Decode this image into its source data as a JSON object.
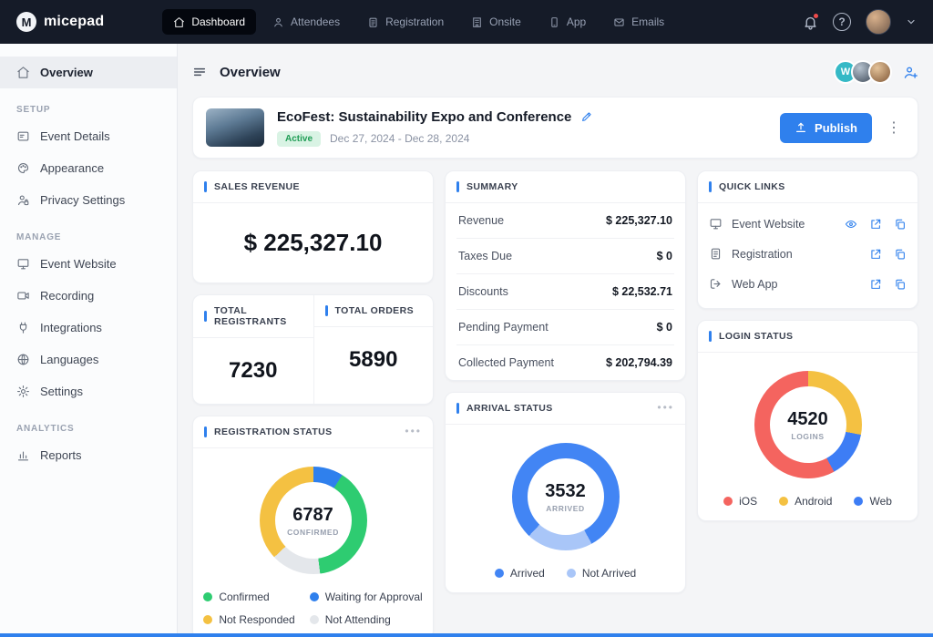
{
  "topbar": {
    "brand": "micepad",
    "nav": [
      {
        "label": "Dashboard"
      },
      {
        "label": "Attendees"
      },
      {
        "label": "Registration"
      },
      {
        "label": "Onsite"
      },
      {
        "label": "App"
      },
      {
        "label": "Emails"
      }
    ]
  },
  "glyphs": {
    "kebab": "⋮",
    "ellipsis": "•••",
    "chevron": "⌄",
    "question": "?"
  },
  "sidebar": {
    "overview": "Overview",
    "sections": [
      {
        "title": "Setup",
        "items": [
          {
            "label": "Event Details"
          },
          {
            "label": "Appearance"
          },
          {
            "label": "Privacy Settings"
          }
        ]
      },
      {
        "title": "Manage",
        "items": [
          {
            "label": "Event Website"
          },
          {
            "label": "Recording"
          },
          {
            "label": "Integrations"
          },
          {
            "label": "Languages"
          },
          {
            "label": "Settings"
          }
        ]
      },
      {
        "title": "Analytics",
        "items": [
          {
            "label": "Reports"
          }
        ]
      }
    ]
  },
  "header": {
    "title": "Overview",
    "collab_initial": "W"
  },
  "event": {
    "title": "EcoFest: Sustainability Expo and Conference",
    "status": "Active",
    "dates": "Dec 27, 2024 - Dec 28, 2024",
    "publish_label": "Publish"
  },
  "sales": {
    "title": "SALES REVENUE",
    "value": "$ 225,327.10"
  },
  "totals": {
    "registrants": {
      "title": "TOTAL REGISTRANTS",
      "value": "7230"
    },
    "orders": {
      "title": "TOTAL ORDERS",
      "value": "5890"
    }
  },
  "summary": {
    "title": "SUMMARY",
    "rows": [
      {
        "label": "Revenue",
        "value": "$ 225,327.10"
      },
      {
        "label": "Taxes Due",
        "value": "$ 0"
      },
      {
        "label": "Discounts",
        "value": "$ 22,532.71"
      },
      {
        "label": "Pending Payment",
        "value": "$ 0"
      },
      {
        "label": "Collected Payment",
        "value": "$ 202,794.39"
      }
    ]
  },
  "quick_links": {
    "title": "QUICK LINKS",
    "items": [
      {
        "label": "Event Website"
      },
      {
        "label": "Registration"
      },
      {
        "label": "Web App"
      }
    ]
  },
  "charts": {
    "registration": {
      "title": "REGISTRATION STATUS",
      "center_value": "6787",
      "center_label": "CONFIRMED",
      "type": "donut",
      "slices": [
        {
          "color": "#2f80ed",
          "pct": 9
        },
        {
          "color": "#2ecc71",
          "pct": 39
        },
        {
          "color": "#e4e7eb",
          "pct": 15
        },
        {
          "color": "#f4c142",
          "pct": 37
        }
      ],
      "legend": [
        {
          "label": "Confirmed",
          "color": "#2ecc71"
        },
        {
          "label": "Waiting for Approval",
          "color": "#2f80ed"
        },
        {
          "label": "Not Responded",
          "color": "#f4c142"
        },
        {
          "label": "Not Attending",
          "color": "#e4e7eb"
        }
      ]
    },
    "arrival": {
      "title": "ARRIVAL STATUS",
      "center_value": "3532",
      "center_label": "ARRIVED",
      "type": "donut",
      "slices": [
        {
          "color": "#4285f4",
          "pct": 42
        },
        {
          "color": "#a9c6f8",
          "pct": 20
        },
        {
          "color": "#4285f4",
          "pct": 38
        }
      ],
      "legend": [
        {
          "label": "Arrived",
          "color": "#4285f4"
        },
        {
          "label": "Not Arrived",
          "color": "#a9c6f8"
        }
      ]
    },
    "login": {
      "title": "LOGIN STATUS",
      "center_value": "4520",
      "center_label": "LOGINS",
      "type": "donut",
      "slices": [
        {
          "color": "#f4c142",
          "pct": 28
        },
        {
          "color": "#3d7df5",
          "pct": 14
        },
        {
          "color": "#f4645f",
          "pct": 58
        }
      ],
      "legend": [
        {
          "label": "iOS",
          "color": "#f4645f"
        },
        {
          "label": "Android",
          "color": "#f4c142"
        },
        {
          "label": "Web",
          "color": "#3d7df5"
        }
      ]
    }
  }
}
